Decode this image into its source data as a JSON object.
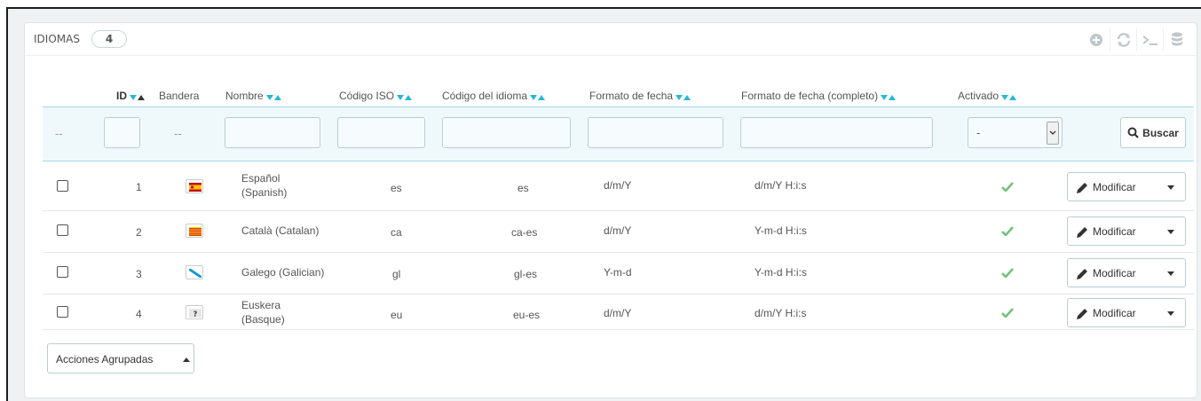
{
  "panel": {
    "title": "IDIOMAS",
    "count": "4",
    "toolbar": [
      {
        "name": "add-new-icon"
      },
      {
        "name": "refresh-icon"
      },
      {
        "name": "sql-query-icon"
      },
      {
        "name": "export-database-icon"
      }
    ]
  },
  "columns": {
    "id": "ID",
    "flag": "Bandera",
    "name": "Nombre",
    "iso": "Código ISO",
    "lang_code": "Código del idioma",
    "date_format": "Formato de fecha",
    "date_format_full": "Formato de fecha (completo)",
    "active": "Activado"
  },
  "filters": {
    "dash": "--",
    "active_select_value": "-",
    "search_label": "Buscar"
  },
  "rows": [
    {
      "id": "1",
      "name_line1": "Español",
      "name_line2": "(Spanish)",
      "iso": "es",
      "lang_code": "es",
      "date_format": "d/m/Y",
      "date_format_full": "d/m/Y H:i:s",
      "flag_icon": "spain-flag-icon",
      "active": true
    },
    {
      "id": "2",
      "name_line1": "Català (Catalan)",
      "name_line2": "",
      "iso": "ca",
      "lang_code": "ca-es",
      "date_format": "d/m/Y",
      "date_format_full": "Y-m-d H:i:s",
      "flag_icon": "catalonia-flag-icon",
      "active": true
    },
    {
      "id": "3",
      "name_line1": "Galego (Galician)",
      "name_line2": "",
      "iso": "gl",
      "lang_code": "gl-es",
      "date_format": "Y-m-d",
      "date_format_full": "Y-m-d H:i:s",
      "flag_icon": "galicia-flag-icon",
      "active": true
    },
    {
      "id": "4",
      "name_line1": "Euskera",
      "name_line2": "(Basque)",
      "iso": "eu",
      "lang_code": "eu-es",
      "date_format": "d/m/Y",
      "date_format_full": "d/m/Y H:i:s",
      "flag_icon": "unknown-flag-icon",
      "active": true
    }
  ],
  "row_actions": {
    "edit_label": "Modificar"
  },
  "bulk_actions": {
    "label": "Acciones Agrupadas"
  },
  "colors": {
    "accent": "#25b9d7",
    "active_check": "#72c279",
    "filter_bg": "#eff9fc"
  }
}
